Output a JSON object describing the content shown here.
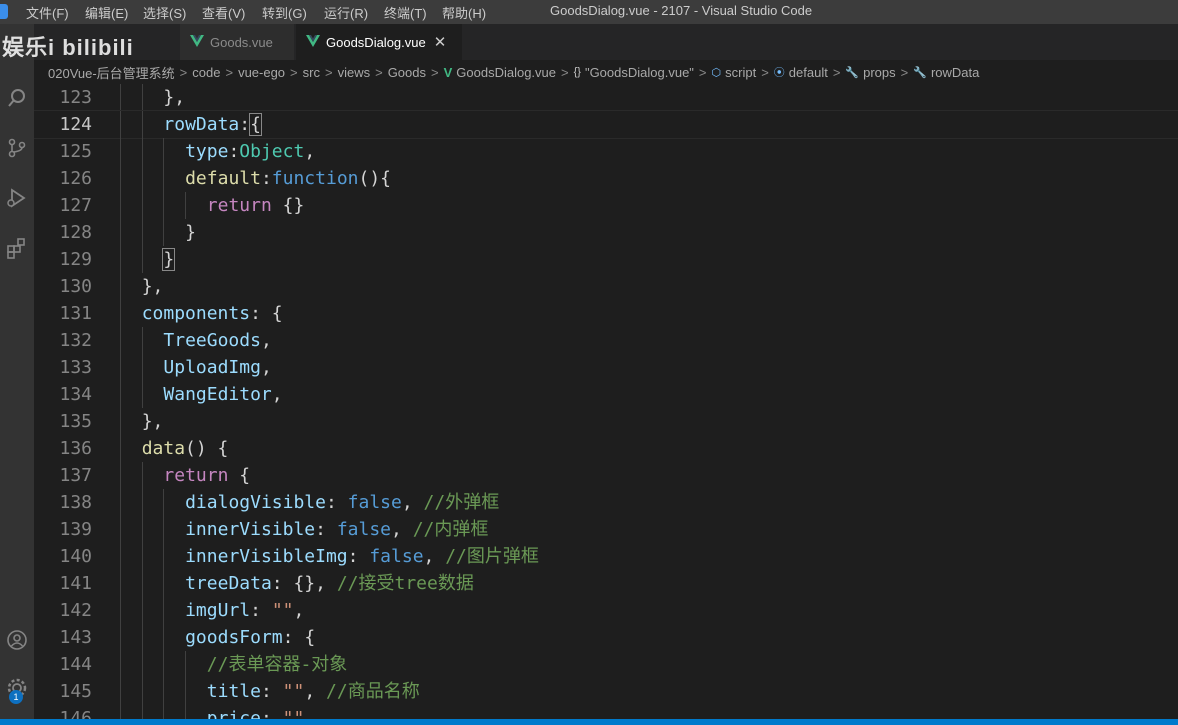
{
  "menu": {
    "items": [
      "文件(F)",
      "编辑(E)",
      "选择(S)",
      "查看(V)",
      "转到(G)",
      "运行(R)",
      "终端(T)",
      "帮助(H)"
    ]
  },
  "window": {
    "title": "GoodsDialog.vue - 2107 - Visual Studio Code"
  },
  "watermark": {
    "text": "娱乐i bilibili"
  },
  "tabs": [
    {
      "label": "Goods.vue",
      "active": false
    },
    {
      "label": "GoodsDialog.vue",
      "active": true,
      "close": "✕"
    }
  ],
  "breadcrumb": {
    "items": [
      "020Vue-后台管理系统",
      "code",
      "vue-ego",
      "src",
      "views",
      "Goods",
      "GoodsDialog.vue",
      "\"GoodsDialog.vue\"",
      "script",
      "default",
      "props",
      "rowData"
    ],
    "separator": ">"
  },
  "editor": {
    "current_line": 124,
    "lines": [
      {
        "n": "123",
        "indent": 2,
        "tokens": [
          {
            "t": "},",
            "c": "pun"
          }
        ]
      },
      {
        "n": "124",
        "indent": 2,
        "tokens": [
          {
            "t": "rowData",
            "c": "prop"
          },
          {
            "t": ":",
            "c": "pun"
          },
          {
            "t": "{",
            "c": "pun",
            "hl": true
          }
        ]
      },
      {
        "n": "125",
        "indent": 3,
        "tokens": [
          {
            "t": "type",
            "c": "prop"
          },
          {
            "t": ":",
            "c": "pun"
          },
          {
            "t": "Object",
            "c": "type"
          },
          {
            "t": ",",
            "c": "pun"
          }
        ]
      },
      {
        "n": "126",
        "indent": 3,
        "tokens": [
          {
            "t": "default",
            "c": "fn"
          },
          {
            "t": ":",
            "c": "pun"
          },
          {
            "t": "function",
            "c": "kw"
          },
          {
            "t": "(){",
            "c": "pun"
          }
        ]
      },
      {
        "n": "127",
        "indent": 4,
        "tokens": [
          {
            "t": "return",
            "c": "kwc"
          },
          {
            "t": " {}",
            "c": "pun"
          }
        ]
      },
      {
        "n": "128",
        "indent": 3,
        "tokens": [
          {
            "t": "}",
            "c": "pun"
          }
        ]
      },
      {
        "n": "129",
        "indent": 2,
        "tokens": [
          {
            "t": "}",
            "c": "pun",
            "hl": true
          }
        ]
      },
      {
        "n": "130",
        "indent": 1,
        "tokens": [
          {
            "t": "},",
            "c": "pun"
          }
        ]
      },
      {
        "n": "131",
        "indent": 1,
        "tokens": [
          {
            "t": "components",
            "c": "prop"
          },
          {
            "t": ": {",
            "c": "pun"
          }
        ]
      },
      {
        "n": "132",
        "indent": 2,
        "tokens": [
          {
            "t": "TreeGoods",
            "c": "prop"
          },
          {
            "t": ",",
            "c": "pun"
          }
        ]
      },
      {
        "n": "133",
        "indent": 2,
        "tokens": [
          {
            "t": "UploadImg",
            "c": "prop"
          },
          {
            "t": ",",
            "c": "pun"
          }
        ]
      },
      {
        "n": "134",
        "indent": 2,
        "tokens": [
          {
            "t": "WangEditor",
            "c": "prop"
          },
          {
            "t": ",",
            "c": "pun"
          }
        ]
      },
      {
        "n": "135",
        "indent": 1,
        "tokens": [
          {
            "t": "},",
            "c": "pun"
          }
        ]
      },
      {
        "n": "136",
        "indent": 1,
        "tokens": [
          {
            "t": "data",
            "c": "fn"
          },
          {
            "t": "() {",
            "c": "pun"
          }
        ]
      },
      {
        "n": "137",
        "indent": 2,
        "tokens": [
          {
            "t": "return",
            "c": "kwc"
          },
          {
            "t": " {",
            "c": "pun"
          }
        ]
      },
      {
        "n": "138",
        "indent": 3,
        "tokens": [
          {
            "t": "dialogVisible",
            "c": "prop"
          },
          {
            "t": ": ",
            "c": "pun"
          },
          {
            "t": "false",
            "c": "kw"
          },
          {
            "t": ", ",
            "c": "pun"
          },
          {
            "t": "//外弹框",
            "c": "com"
          }
        ]
      },
      {
        "n": "139",
        "indent": 3,
        "tokens": [
          {
            "t": "innerVisible",
            "c": "prop"
          },
          {
            "t": ": ",
            "c": "pun"
          },
          {
            "t": "false",
            "c": "kw"
          },
          {
            "t": ", ",
            "c": "pun"
          },
          {
            "t": "//内弹框",
            "c": "com"
          }
        ]
      },
      {
        "n": "140",
        "indent": 3,
        "tokens": [
          {
            "t": "innerVisibleImg",
            "c": "prop"
          },
          {
            "t": ": ",
            "c": "pun"
          },
          {
            "t": "false",
            "c": "kw"
          },
          {
            "t": ", ",
            "c": "pun"
          },
          {
            "t": "//图片弹框",
            "c": "com"
          }
        ]
      },
      {
        "n": "141",
        "indent": 3,
        "tokens": [
          {
            "t": "treeData",
            "c": "prop"
          },
          {
            "t": ": {}, ",
            "c": "pun"
          },
          {
            "t": "//接受tree数据",
            "c": "com"
          }
        ]
      },
      {
        "n": "142",
        "indent": 3,
        "tokens": [
          {
            "t": "imgUrl",
            "c": "prop"
          },
          {
            "t": ": ",
            "c": "pun"
          },
          {
            "t": "\"\"",
            "c": "str"
          },
          {
            "t": ",",
            "c": "pun"
          }
        ]
      },
      {
        "n": "143",
        "indent": 3,
        "tokens": [
          {
            "t": "goodsForm",
            "c": "prop"
          },
          {
            "t": ": {",
            "c": "pun"
          }
        ]
      },
      {
        "n": "144",
        "indent": 4,
        "tokens": [
          {
            "t": "//表单容器-对象",
            "c": "com"
          }
        ]
      },
      {
        "n": "145",
        "indent": 4,
        "tokens": [
          {
            "t": "title",
            "c": "prop"
          },
          {
            "t": ": ",
            "c": "pun"
          },
          {
            "t": "\"\"",
            "c": "str"
          },
          {
            "t": ", ",
            "c": "pun"
          },
          {
            "t": "//商品名称",
            "c": "com"
          }
        ]
      },
      {
        "n": "146",
        "indent": 4,
        "tokens": [
          {
            "t": "price",
            "c": "prop"
          },
          {
            "t": ": ",
            "c": "pun"
          },
          {
            "t": "\"\"",
            "c": "str"
          }
        ]
      }
    ]
  },
  "status_bar": {
    "color": "#007acc"
  }
}
